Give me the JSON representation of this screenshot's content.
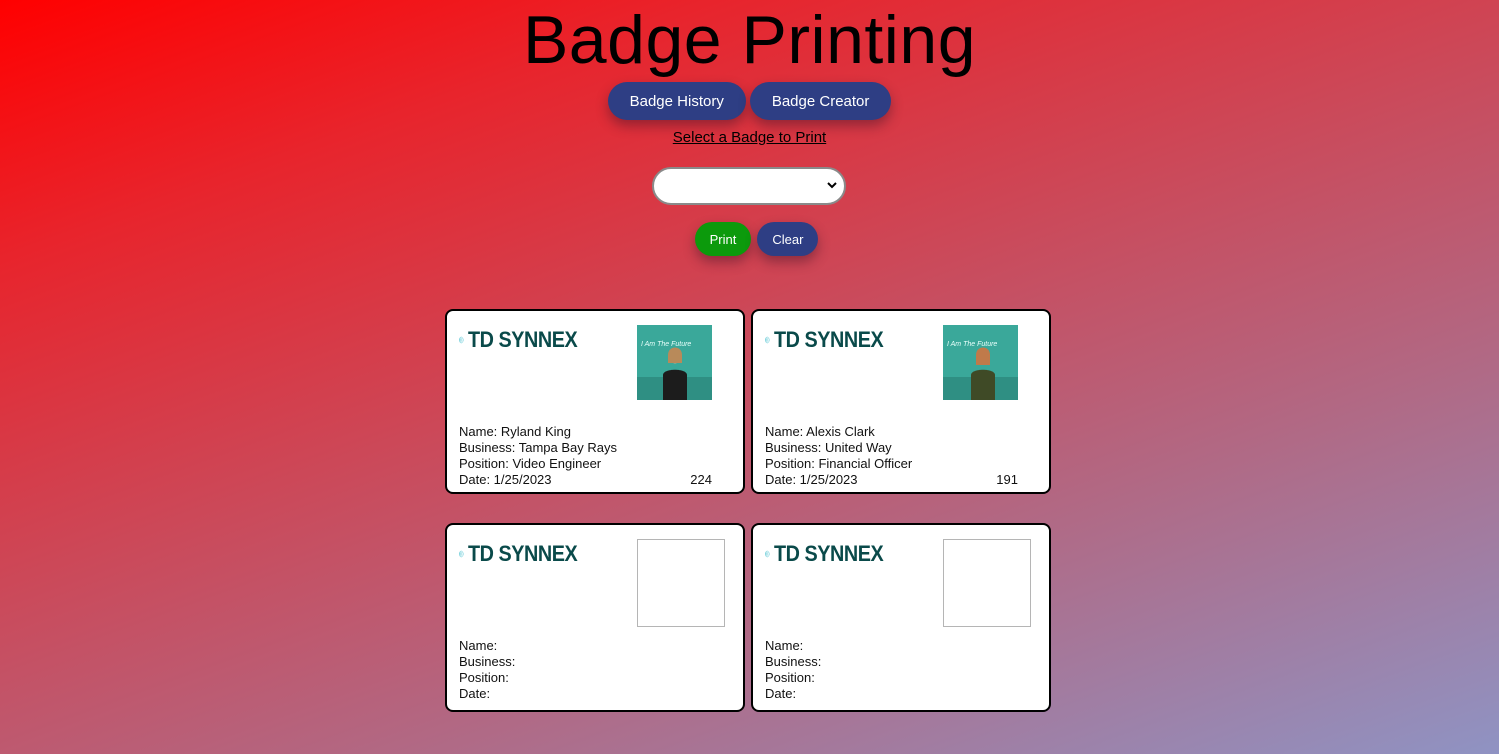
{
  "page": {
    "title": "Badge Printing",
    "nav": {
      "history_label": "Badge History",
      "creator_label": "Badge Creator"
    },
    "select_label": "Select a Badge to Print",
    "select_value": "",
    "actions": {
      "print_label": "Print",
      "clear_label": "Clear"
    }
  },
  "colors": {
    "nav_button": "#2e3e84",
    "print_button": "#0c9a0c",
    "logo_teal": "#0a4a4a"
  },
  "badges": [
    {
      "logo_text": "TD SYNNEX",
      "photo_caption": "I Am The Future",
      "name": "Name: Ryland King",
      "business": "Business: Tampa Bay Rays",
      "position": "Position: Video Engineer",
      "date": "Date: 1/25/2023",
      "number": "224"
    },
    {
      "logo_text": "TD SYNNEX",
      "photo_caption": "I Am The Future",
      "name": "Name: Alexis Clark",
      "business": "Business: United Way",
      "position": "Position: Financial Officer",
      "date": "Date: 1/25/2023",
      "number": "191"
    },
    {
      "logo_text": "TD SYNNEX",
      "name": "Name:",
      "business": "Business:",
      "position": "Position:",
      "date": "Date:"
    },
    {
      "logo_text": "TD SYNNEX",
      "name": "Name:",
      "business": "Business:",
      "position": "Position:",
      "date": "Date:"
    }
  ]
}
